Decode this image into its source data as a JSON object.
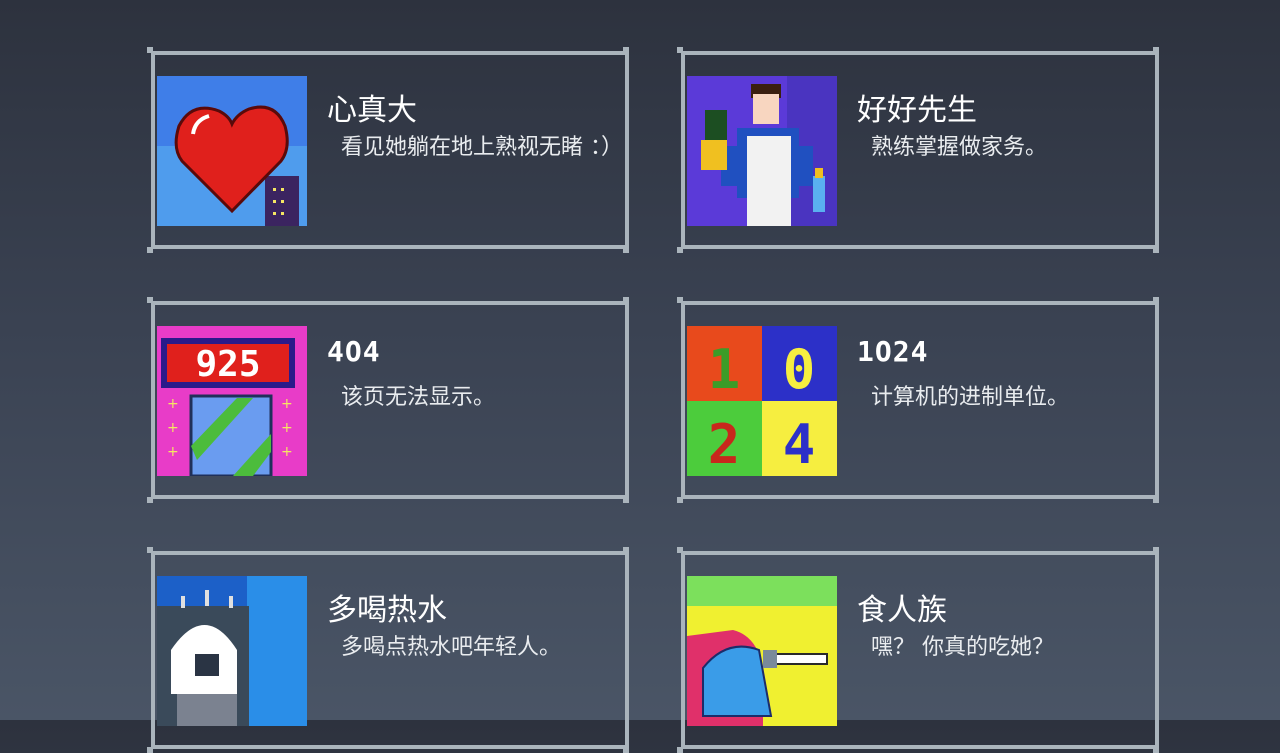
{
  "achievements": [
    {
      "title": "心真大",
      "description": "看见她躺在地上熟视无睹 ：）",
      "icon": "heart-icon"
    },
    {
      "title": "好好先生",
      "description": "熟练掌握做家务。",
      "icon": "housework-man-icon"
    },
    {
      "title": "4O4",
      "description": "该页无法显示。",
      "icon": "gift-925-icon",
      "display_number": "925"
    },
    {
      "title": "1O24",
      "description": "计算机的进制单位。",
      "icon": "number-tiles-icon",
      "digits": [
        "1",
        "0",
        "2",
        "4"
      ]
    },
    {
      "title": "多喝热水",
      "description": "多喝点热水吧年轻人。",
      "icon": "hot-water-kettle-icon"
    },
    {
      "title": "食人族",
      "description": "嘿？ 你真的吃她？",
      "icon": "cannibal-icon"
    }
  ],
  "colors": {
    "card_border": "#aab4bc",
    "text": "#ffffff",
    "heart": "#e0201c"
  }
}
